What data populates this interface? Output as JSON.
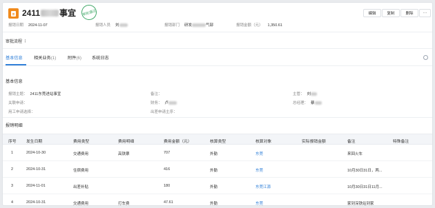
{
  "header": {
    "title_prefix": "2411",
    "title_suffix": "事宜",
    "stamp_text": "审批通过",
    "meta": [
      {
        "key": "报销日期",
        "value": "2024-11-07"
      },
      {
        "key": "报销人员",
        "value": "刘"
      },
      {
        "key": "报销部门",
        "value": "研发"
      },
      {
        "key": "报销金额（元）",
        "value": "1,350.61"
      }
    ],
    "dept_tail": "气部",
    "buttons": [
      "编辑",
      "复制",
      "删除",
      "⋯"
    ]
  },
  "approval": {
    "label": "审批流程",
    "dots": "⠇"
  },
  "tabs": [
    {
      "label": "基本信息",
      "count": ""
    },
    {
      "label": "相关业务",
      "count": "(1)"
    },
    {
      "label": "附件",
      "count": "(6)"
    },
    {
      "label": "系统日志",
      "count": ""
    }
  ],
  "basic": {
    "section": "基本信息",
    "fields": {
      "subject_key": "报销主题：",
      "subject_val": "2411东莞进站事宜",
      "related_key": "关联申请：",
      "related_val": "",
      "usage_key": "用工申请选择：",
      "usage_val": "",
      "remark_key": "备注：",
      "remark_val": "",
      "finance_key": "财务：",
      "finance_val": "卢",
      "travel_key": "出差申请主序：",
      "travel_val": "",
      "manager_key": "主管：",
      "manager_val": "刘",
      "gm_key": "总经理：",
      "gm_val": "蔡"
    }
  },
  "detail": {
    "section": "报销明细",
    "columns": [
      "序号",
      "发生日期",
      "费用类型",
      "费用明细",
      "费用金额（元）",
      "核算类型",
      "核算对象",
      "实际报销金额",
      "备注",
      "特殊备注"
    ],
    "rows": [
      {
        "no": "1",
        "date": "2024-10-30",
        "type": "交通费用",
        "item": "高铁票",
        "amount": "707",
        "acc_type": "外勤",
        "target": "东莞",
        "actual": "",
        "remark": "来回火车",
        "special": ""
      },
      {
        "no": "2",
        "date": "2024-10-31",
        "type": "住宿费用",
        "item": "",
        "amount": "416",
        "acc_type": "外勤",
        "target": "东莞",
        "actual": "",
        "remark": "10月30日31日，两...",
        "special": ""
      },
      {
        "no": "3",
        "date": "2024-11-01",
        "type": "出差补贴",
        "item": "",
        "amount": "180",
        "acc_type": "外勤",
        "target": "东莞江源",
        "actual": "",
        "remark": "10月30日31日11月...",
        "special": ""
      },
      {
        "no": "4",
        "date": "2024-10-31",
        "type": "交通费用",
        "item": "打车费",
        "amount": "47.61",
        "acc_type": "外勤",
        "target": "东莞",
        "actual": "",
        "remark": "家到深铁站到家",
        "special": ""
      }
    ]
  }
}
